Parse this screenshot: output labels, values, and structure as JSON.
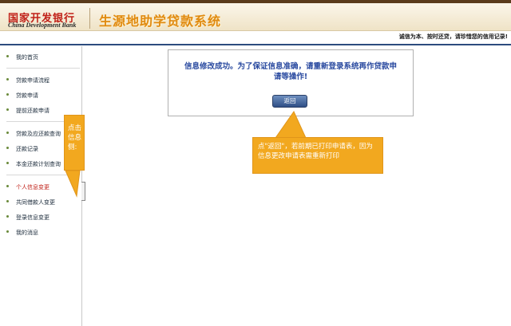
{
  "header": {
    "logo_cn": "国家开发银行",
    "logo_en": "China Development Bank",
    "system_title": "生源地助学贷款系统",
    "slogan": "诚信为本、按时还贷，请珍惜您的信用记录!"
  },
  "sidebar": {
    "items": [
      {
        "label": "我的首页"
      },
      {
        "label": "贷款申请流程"
      },
      {
        "label": "贷款申请"
      },
      {
        "label": "提前还款申请"
      },
      {
        "label": "贷款及应还款查询"
      },
      {
        "label": "还款记录"
      },
      {
        "label": "本金还款计划查询"
      },
      {
        "label": "个人信息变更",
        "active": true
      },
      {
        "label": "共同借款人变更"
      },
      {
        "label": "登录信息变更"
      },
      {
        "label": "我的消息"
      }
    ]
  },
  "message": {
    "text_line1": "信息修改成功。为了保证信息准确，请重新登录系统再作贷款申",
    "text_line2": "请等操作!",
    "back_button": "返回"
  },
  "callouts": {
    "main": "点\"返回\"，若前期已打印申请表，因为信息更改申请表需重新打印",
    "side_line1": "点击",
    "side_line2": "信息",
    "side_line3": "侧:"
  },
  "colors": {
    "callout": "#f2a81f",
    "message_text": "#2a4aa0",
    "active_nav": "#c02018",
    "slogan_bar_border": "#2c4c7e"
  }
}
